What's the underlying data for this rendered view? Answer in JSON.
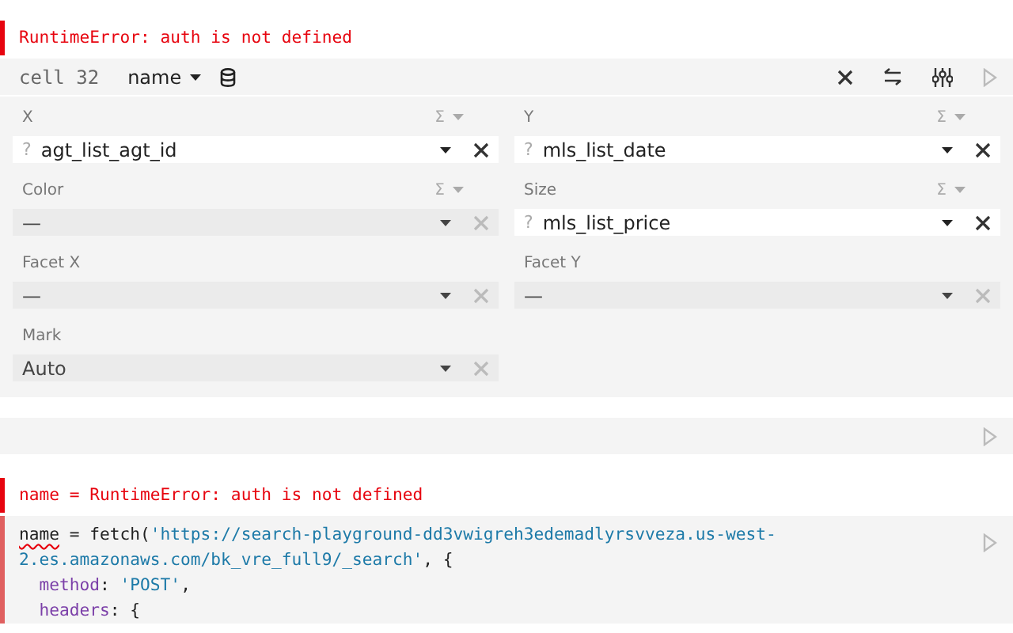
{
  "error_top": {
    "text": "RuntimeError: auth is not defined"
  },
  "chart_cell": {
    "cell_label": "cell 32",
    "source": "name",
    "fields": [
      {
        "label": "X",
        "aggregate": "Σ",
        "type_glyph": "?",
        "value": "agt_list_agt_id",
        "filled": true
      },
      {
        "label": "Y",
        "aggregate": "Σ",
        "type_glyph": "?",
        "value": "mls_list_date",
        "filled": true
      },
      {
        "label": "Color",
        "aggregate": "Σ",
        "value": "—",
        "filled": false
      },
      {
        "label": "Size",
        "aggregate": "Σ",
        "type_glyph": "?",
        "value": "mls_list_price",
        "filled": true
      },
      {
        "label": "Facet X",
        "value": "—",
        "filled": false
      },
      {
        "label": "Facet Y",
        "value": "—",
        "filled": false
      },
      {
        "label": "Mark",
        "value": "Auto",
        "filled": false
      }
    ]
  },
  "error_bottom": {
    "text": "name = RuntimeError: auth is not defined"
  },
  "code_cell": {
    "lines": [
      [
        {
          "kind": "error_name",
          "text": "name"
        },
        {
          "kind": "plain",
          "text": " = fetch("
        },
        {
          "kind": "string",
          "text": "'https://search-playground-dd3vwigreh3edemadlyrsvveza.us-west-"
        }
      ],
      [
        {
          "kind": "string",
          "text": "2.es.amazonaws.com/bk_vre_full9/_search'"
        },
        {
          "kind": "plain",
          "text": ", {"
        }
      ],
      [
        {
          "kind": "property",
          "text": "  method"
        },
        {
          "kind": "plain",
          "text": ": "
        },
        {
          "kind": "string",
          "text": "'POST'"
        },
        {
          "kind": "plain",
          "text": ","
        }
      ],
      [
        {
          "kind": "property",
          "text": "  headers"
        },
        {
          "kind": "plain",
          "text": ": {"
        }
      ]
    ]
  }
}
